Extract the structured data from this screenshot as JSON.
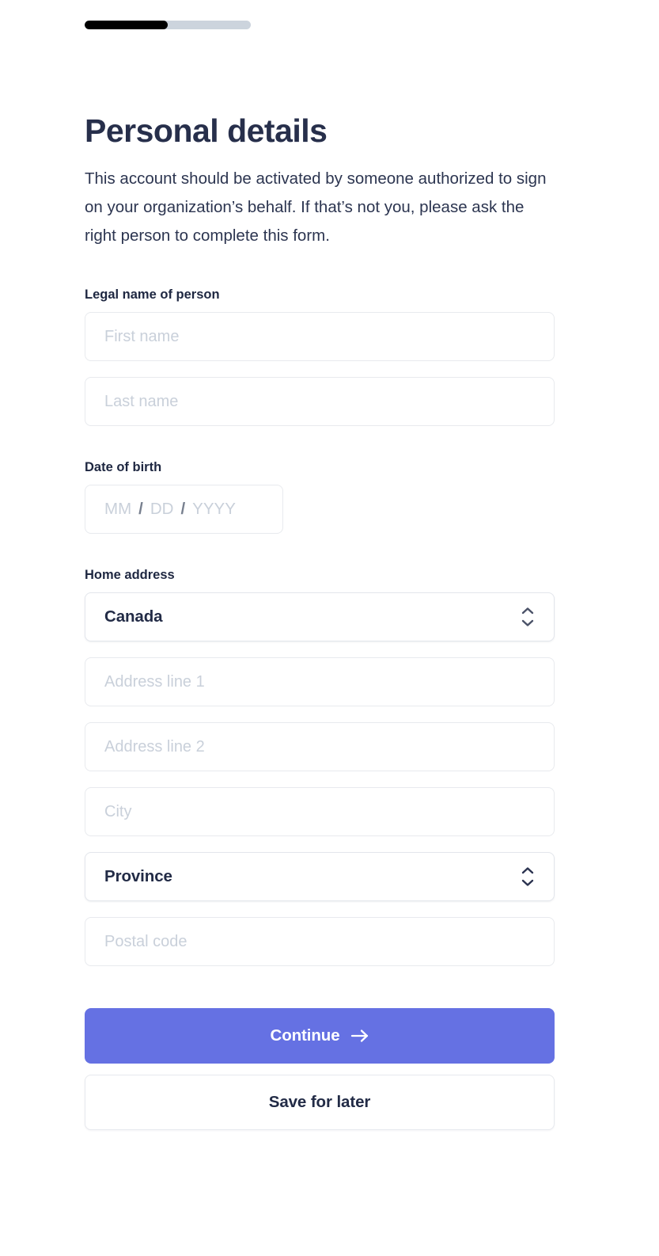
{
  "progress": {
    "name": "form-progress",
    "percent": 50,
    "fill_color": "#000000",
    "track_color": "#ccd4dd"
  },
  "header": {
    "title": "Personal details",
    "description": "This account should be activated by someone authorized to sign on your organization’s behalf. If that’s not you, please ask the right person to complete this form."
  },
  "sections": {
    "legal_name": {
      "label": "Legal name of person",
      "first_name_placeholder": "First name",
      "first_name_value": "",
      "last_name_placeholder": "Last name",
      "last_name_value": ""
    },
    "date_of_birth": {
      "label": "Date of birth",
      "month_placeholder": "MM",
      "day_placeholder": "DD",
      "year_placeholder": "YYYY",
      "separator": "/",
      "value": ""
    },
    "home_address": {
      "label": "Home address",
      "country_value": "Canada",
      "address_line_1_placeholder": "Address line 1",
      "address_line_1_value": "",
      "address_line_2_placeholder": "Address line 2",
      "address_line_2_value": "",
      "city_placeholder": "City",
      "city_value": "",
      "province_value": "Province",
      "postal_code_placeholder": "Postal code",
      "postal_code_value": ""
    }
  },
  "actions": {
    "continue_label": "Continue",
    "continue_icon": "arrow-right-icon",
    "save_label": "Save for later"
  },
  "icons": {
    "select_chevrons": "chevron-up-down-icon"
  },
  "colors": {
    "primary_button": "#6571e3",
    "title_text": "#272f4b",
    "body_text": "#2c3550",
    "placeholder": "#c9d0da",
    "field_border": "#e8eaee"
  }
}
